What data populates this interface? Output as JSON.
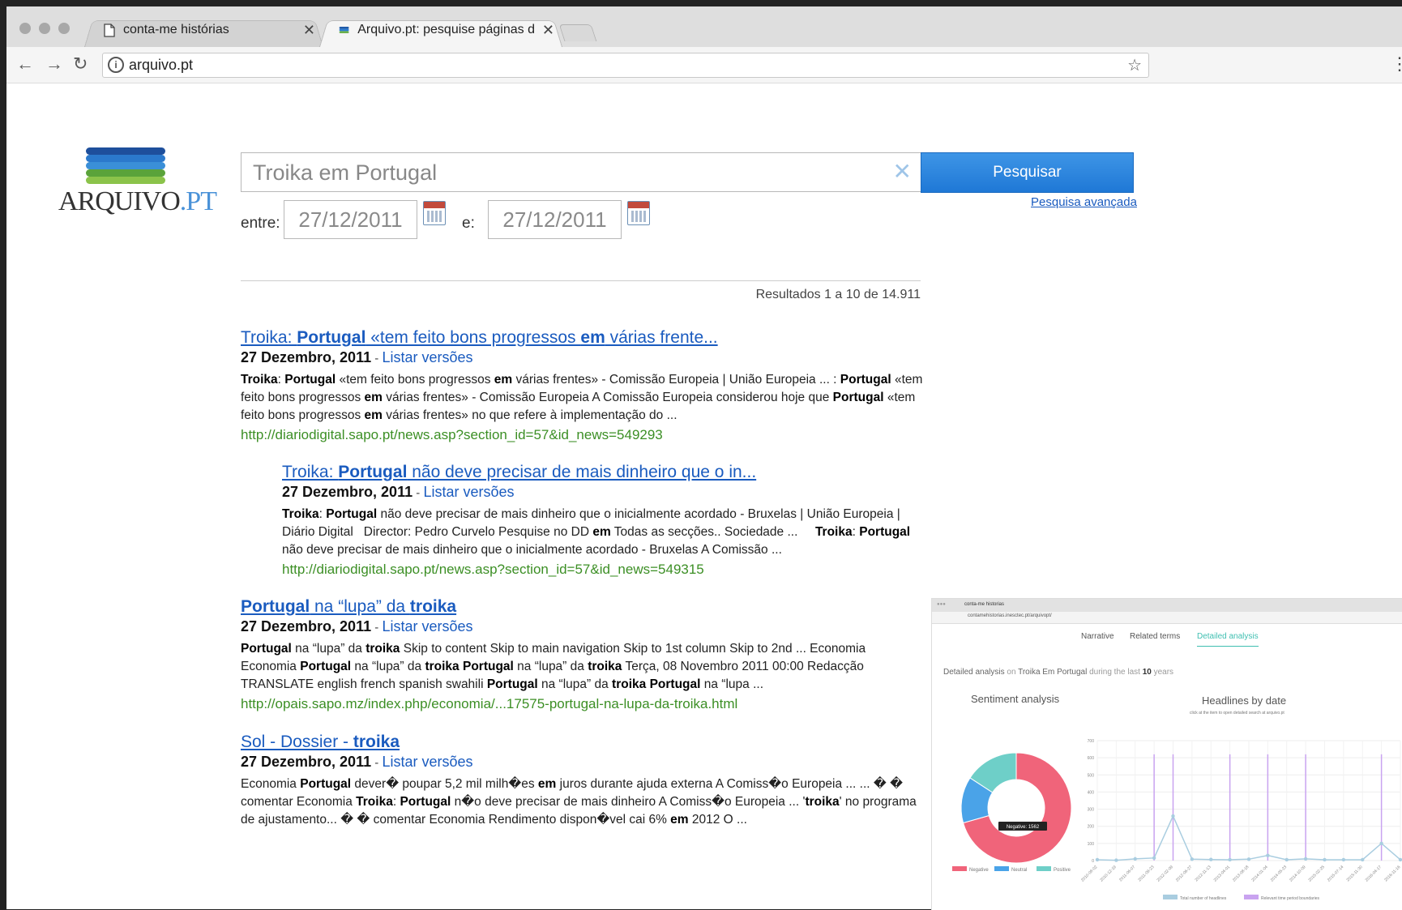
{
  "browser": {
    "tabs": [
      {
        "title": "conta-me histórias",
        "icon": "page-icon"
      },
      {
        "title": "Arquivo.pt: pesquise páginas d",
        "icon": "arquivo-favicon"
      }
    ],
    "url": "arquivo.pt"
  },
  "logo": {
    "text_a": "ARQUIVO",
    "text_b": ".PT"
  },
  "search": {
    "query": "Troika em Portugal",
    "button": "Pesquisar",
    "advanced": "Pesquisa avançada",
    "from_label": "entre:",
    "to_label": "e:",
    "from_date": "27/12/2011",
    "to_date": "27/12/2011"
  },
  "results_count": "Resultados 1 a 10 de 14.911",
  "results": [
    {
      "title_html": "Troika: <b>Portugal</b> «tem feito bons progressos <b>em</b> várias frente...",
      "date": "27 Dezembro, 2011",
      "sep": " - ",
      "versions": "Listar versões",
      "snippet_html": "<b>Troika</b>: <b>Portugal</b> «tem feito bons progressos <b>em</b> várias frentes» - Comissão Europeia | União Europeia ... : <b>Portugal</b> «tem feito bons progressos <b>em</b> várias frentes» - Comissão Europeia A Comissão Europeia considerou hoje que <b>Portugal</b> «tem feito bons progressos <b>em</b> várias frentes» no que refere à implementação do ...",
      "url": "http://diariodigital.sapo.pt/news.asp?section_id=57&id_news=549293"
    },
    {
      "title_html": "Troika: <b>Portugal</b> não deve precisar de mais dinheiro que o in...",
      "date": "27 Dezembro, 2011",
      "sep": " - ",
      "versions": "Listar versões",
      "snippet_html": "<b>Troika</b>: <b>Portugal</b> não deve precisar de mais dinheiro que o inicialmente acordado - Bruxelas | União Europeia | Diário Digital &nbsp; Director: Pedro Curvelo Pesquise no DD <b>em</b> Todas as secções.. Sociedade ... &nbsp;&nbsp;&nbsp; <b>Troika</b>: <b>Portugal</b> não deve precisar de mais dinheiro que o inicialmente acordado - Bruxelas A Comissão ...",
      "url": "http://diariodigital.sapo.pt/news.asp?section_id=57&id_news=549315"
    },
    {
      "title_html": "<b>Portugal</b> na “lupa” da <b>troika</b>",
      "date": "27 Dezembro, 2011",
      "sep": " - ",
      "versions": "Listar versões",
      "snippet_html": "<b>Portugal</b> na “lupa” da <b>troika</b> Skip to content Skip to main navigation Skip to 1st column Skip to 2nd ... Economia Economia <b>Portugal</b> na “lupa” da <b>troika</b> <b>Portugal</b> na “lupa” da <b>troika</b> Terça, 08 Novembro 2011 00:00 Redacção TRANSLATE english french spanish swahili <b>Portugal</b> na “lupa” da <b>troika</b> <b>Portugal</b> na “lupa ...",
      "url": "http://opais.sapo.mz/index.php/economia/...17575-portugal-na-lupa-da-troika.html"
    },
    {
      "title_html": "Sol - Dossier - <b>troika</b>",
      "date": "27 Dezembro, 2011",
      "sep": " - ",
      "versions": "Listar versões",
      "snippet_html": "Economia <b>Portugal</b> dever� poupar 5,2 mil milh�es <b>em</b> juros durante ajuda externa A Comiss�o Europeia ... ... � � comentar Economia <b>Troika</b>: <b>Portugal</b> n�o deve precisar de mais dinheiro A Comiss�o Europeia ... '<b>troika</b>' no programa de ajustamento... � � comentar Economia Rendimento dispon�vel cai 6% <b>em</b> 2012 O ...",
      "url": ""
    }
  ],
  "thumbnail": {
    "tab_title": "conta-me historias",
    "url": "contamehistorias.inesctec.pt/arquivopt/",
    "nav": [
      "Narrative",
      "Related terms",
      "Detailed analysis"
    ],
    "headline": {
      "a": "Detailed analysis",
      "b": " on ",
      "c": "Troika Em Portugal",
      "d": " during the last ",
      "e": "10",
      "f": " years"
    },
    "sentiment_title": "Sentiment analysis",
    "headlines_title": "Headlines by date",
    "headlines_sub": "click at the item to open detailed search at arquivo.pt",
    "tooltip": "Negative: 1562"
  },
  "chart_data": [
    {
      "type": "pie",
      "title": "Sentiment analysis",
      "categories": [
        "Negative",
        "Neutral",
        "Positive"
      ],
      "values": [
        1562,
        300,
        350
      ],
      "colors": [
        "#f0647a",
        "#4aa3e8",
        "#6ecfc8"
      ],
      "legend_position": "bottom"
    },
    {
      "type": "line",
      "title": "Headlines by date",
      "ylim": [
        0,
        700
      ],
      "yticks": [
        0,
        100,
        200,
        300,
        400,
        500,
        600,
        700
      ],
      "x": [
        "2010-08-02",
        "2010-12-19",
        "2011-06-07",
        "2011-09-23",
        "2012-02-09",
        "2012-06-27",
        "2012-11-13",
        "2013-04-01",
        "2013-08-18",
        "2014-01-04",
        "2014-05-23",
        "2014-10-09",
        "2015-02-25",
        "2015-07-14",
        "2015-11-30",
        "2016-04-17",
        "2016-11-16"
      ],
      "series": [
        {
          "name": "Total number of headlines",
          "values": [
            5,
            2,
            10,
            15,
            260,
            8,
            6,
            5,
            8,
            30,
            5,
            10,
            5,
            5,
            5,
            100,
            5
          ],
          "color": "#a9cde0"
        },
        {
          "name": "Relevant time period boundaries",
          "color": "#c9a3f0",
          "spike_indices": [
            3,
            4,
            7,
            9,
            11,
            15
          ]
        }
      ],
      "spike_value": 620,
      "grid": true,
      "legend_position": "bottom"
    }
  ]
}
